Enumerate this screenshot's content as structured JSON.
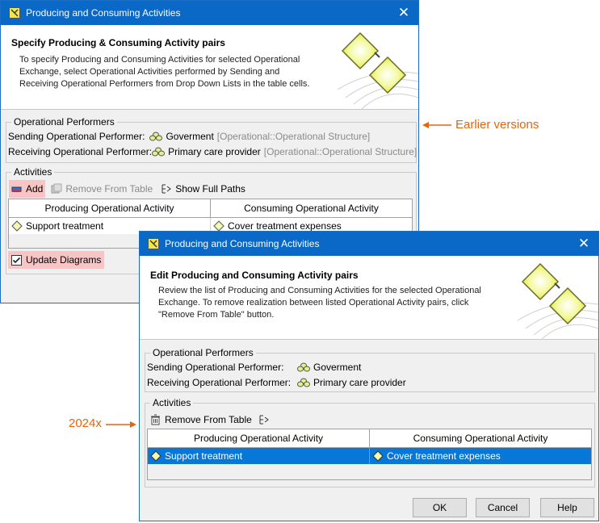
{
  "window_old": {
    "title": "Producing and Consuming Activities",
    "header_title": "Specify Producing & Consuming Activity pairs",
    "header_desc": [
      "To specify Producing and Consuming Activities for selected Operational",
      "Exchange, select Operational Activities performed by Sending and",
      "Receiving Operational Performers from Drop Down Lists in the table cells."
    ],
    "performers_legend": "Operational Performers",
    "sending_label": "Sending Operational Performer:",
    "sending_value": "Goverment",
    "sending_type": "[Operational::Operational Structure]",
    "receiving_label": "Receiving Operational Performer:",
    "receiving_value": "Primary care provider",
    "receiving_type": "[Operational::Operational Structure]",
    "activities_legend": "Activities",
    "add_label": "Add",
    "remove_label": "Remove From Table",
    "paths_label": "Show Full Paths",
    "col_producing": "Producing Operational Activity",
    "col_consuming": "Consuming Operational Activity",
    "row_producing": "Support treatment",
    "row_consuming": "Cover treatment expenses",
    "update_label": "Update Diagrams"
  },
  "window_new": {
    "title": "Producing and Consuming Activities",
    "header_title": "Edit Producing and Consuming Activity pairs",
    "header_desc": [
      "Review the list of Producing and Consuming Activities for the selected Operational",
      "Exchange. To remove realization between listed Operational Activity pairs, click",
      "\"Remove From Table\" button."
    ],
    "performers_legend": "Operational Performers",
    "sending_label": "Sending Operational Performer:",
    "sending_value": "Goverment",
    "receiving_label": "Receiving Operational Performer:",
    "receiving_value": "Primary care provider",
    "activities_legend": "Activities",
    "remove_label": "Remove From Table",
    "col_producing": "Producing Operational Activity",
    "col_consuming": "Consuming Operational Activity",
    "row_producing": "Support treatment",
    "row_consuming": "Cover treatment expenses",
    "ok_label": "OK",
    "cancel_label": "Cancel",
    "help_label": "Help"
  },
  "annotations": {
    "earlier": "Earlier versions",
    "current": "2024x"
  },
  "colors": {
    "titlebar": "#0a68c7",
    "selection": "#0778d7",
    "annotation": "#e8630b",
    "highlight": "#f7c5c5"
  },
  "icons": [
    "app-icon",
    "close-icon",
    "performer-icon",
    "activity-icon",
    "add-icon",
    "remove-icon",
    "paths-icon",
    "checkbox-checked-icon",
    "arrow-left-icon",
    "arrow-right-icon"
  ]
}
